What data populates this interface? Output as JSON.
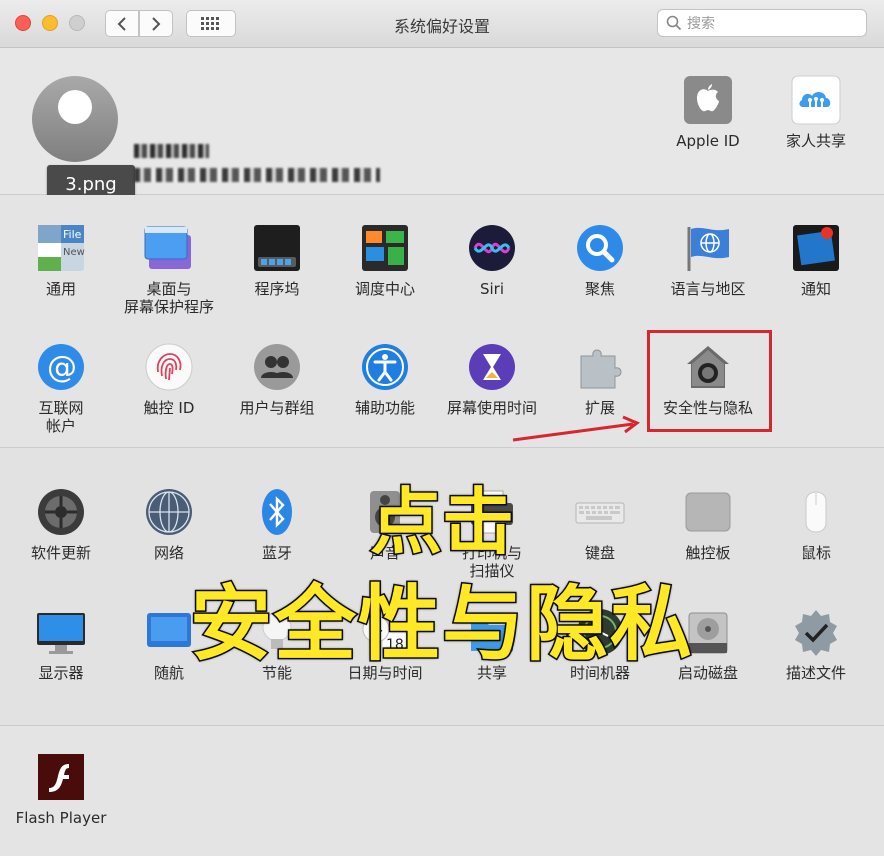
{
  "window": {
    "title": "系统偏好设置"
  },
  "search": {
    "placeholder": "搜索"
  },
  "profile": {
    "file_tag": "3.png",
    "apple_id_label": "Apple ID",
    "family_label": "家人共享"
  },
  "row1": [
    {
      "label": "通用"
    },
    {
      "label": "桌面与\n屏幕保护程序"
    },
    {
      "label": "程序坞"
    },
    {
      "label": "调度中心"
    },
    {
      "label": "Siri"
    },
    {
      "label": "聚焦"
    },
    {
      "label": "语言与地区"
    },
    {
      "label": "通知"
    }
  ],
  "row2": [
    {
      "label": "互联网\n帐户"
    },
    {
      "label": "触控 ID"
    },
    {
      "label": "用户与群组"
    },
    {
      "label": "辅助功能"
    },
    {
      "label": "屏幕使用时间"
    },
    {
      "label": "扩展"
    },
    {
      "label": "安全性与隐私"
    }
  ],
  "row3": [
    {
      "label": "软件更新"
    },
    {
      "label": "网络"
    },
    {
      "label": "蓝牙"
    },
    {
      "label": "声音"
    },
    {
      "label": "打印机与\n扫描仪"
    },
    {
      "label": "键盘"
    },
    {
      "label": "触控板"
    },
    {
      "label": "鼠标"
    }
  ],
  "row4": [
    {
      "label": "显示器"
    },
    {
      "label": "随航"
    },
    {
      "label": "节能"
    },
    {
      "label": "日期与时间"
    },
    {
      "label": "共享"
    },
    {
      "label": "时间机器"
    },
    {
      "label": "启动磁盘"
    },
    {
      "label": "描述文件"
    }
  ],
  "row5": [
    {
      "label": "Flash Player"
    }
  ],
  "date_icon": {
    "day": "18"
  },
  "overlay": {
    "line1": "点击",
    "line2": "安全性与隐私"
  },
  "colors": {
    "highlight": "#d8262f",
    "overlay_text": "#ffe926"
  }
}
